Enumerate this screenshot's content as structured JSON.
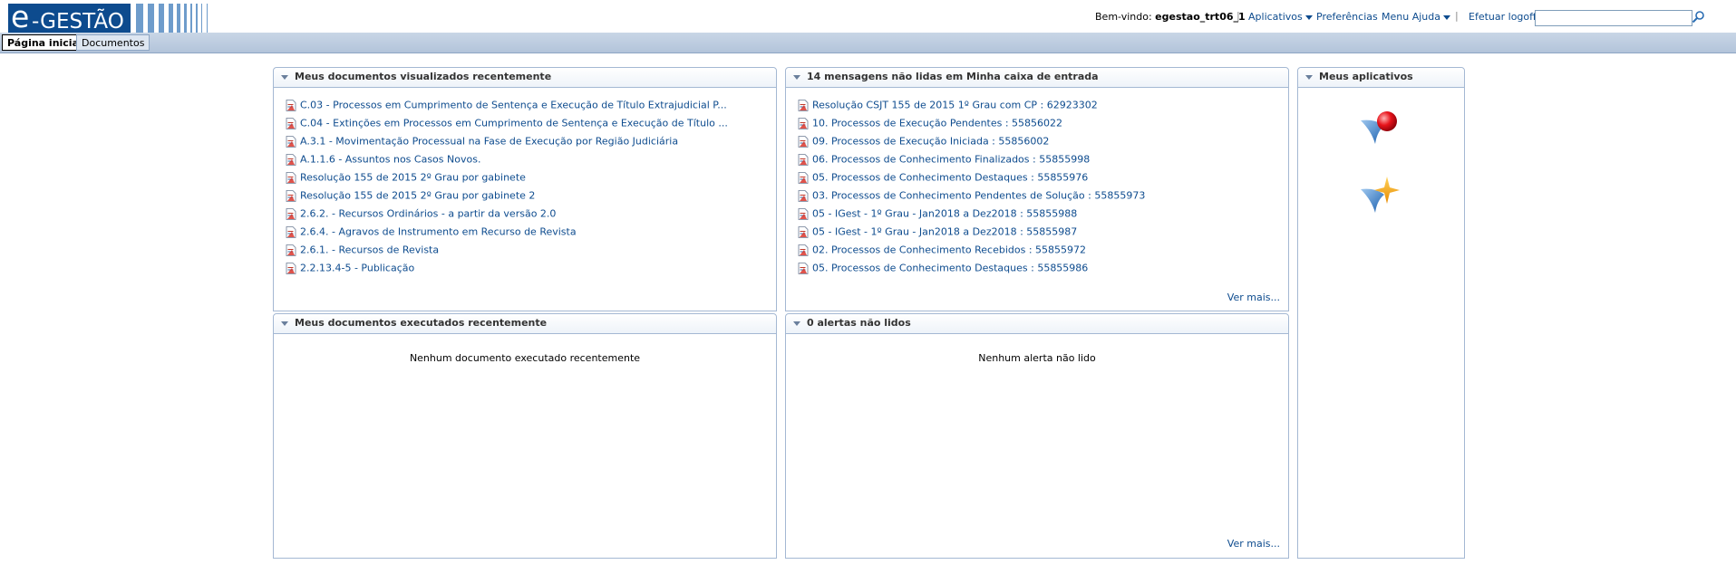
{
  "header": {
    "logo_e": "e",
    "logo_text": "-GESTÃO",
    "welcome_label": "Bem-vindo:",
    "username": "egestao_trt06_1",
    "apps_label": "Aplicativos",
    "prefs_label": "Preferências",
    "help_label": "Menu Ajuda",
    "logoff_label": "Efetuar logoff",
    "search_value": ""
  },
  "tabs": [
    {
      "label": "Página inicial"
    },
    {
      "label": "Documentos"
    }
  ],
  "recent_viewed": {
    "title": "Meus documentos visualizados recentemente",
    "items": [
      "C.03 - Processos em Cumprimento de Sentença e Execução de Título Extrajudicial P...",
      "C.04 - Extinções em Processos em Cumprimento de Sentença e Execução de Título ...",
      "A.3.1 - Movimentação Processual na Fase de Execução por Região Judiciária",
      "A.1.1.6 - Assuntos nos Casos Novos.",
      "Resolução 155 de 2015 2º Grau por gabinete",
      "Resolução 155 de 2015 2º Grau por gabinete 2",
      "2.6.2. - Recursos Ordinários - a partir da versão 2.0",
      "2.6.4. - Agravos de Instrumento em Recurso de Revista",
      "2.6.1. - Recursos de Revista",
      "2.2.13.4-5 - Publicação"
    ]
  },
  "inbox": {
    "title": "14 mensagens não lidas em Minha caixa de entrada",
    "items": [
      "Resolução CSJT 155 de 2015 1º Grau com CP : 62923302",
      "10. Processos de Execução Pendentes : 55856022",
      "09. Processos de Execução Iniciada : 55856002",
      "06. Processos de Conhecimento Finalizados : 55855998",
      "05. Processos de Conhecimento Destaques : 55855976",
      "03. Processos de Conhecimento Pendentes de Solução : 55855973",
      "05 - IGest - 1º Grau - Jan2018 a Dez2018 : 55855988",
      "05 - IGest - 1º Grau - Jan2018 a Dez2018 : 55855987",
      "02. Processos de Conhecimento Recebidos : 55855972",
      "05. Processos de Conhecimento Destaques : 55855986"
    ],
    "more_label": "Ver mais..."
  },
  "recent_executed": {
    "title": "Meus documentos executados recentemente",
    "empty_message": "Nenhum documento executado recentemente"
  },
  "alerts": {
    "title": "0 alertas não lidos",
    "empty_message": "Nenhum alerta não lido",
    "more_label": "Ver mais..."
  },
  "apps": {
    "title": "Meus aplicativos",
    "icons": [
      "red-sphere-app-icon",
      "star-app-icon"
    ]
  },
  "colors": {
    "brand_blue": "#0d4b8e",
    "link": "#0d4b8e",
    "border": "#a4b8d3",
    "tabbar": "#b3c4da"
  }
}
